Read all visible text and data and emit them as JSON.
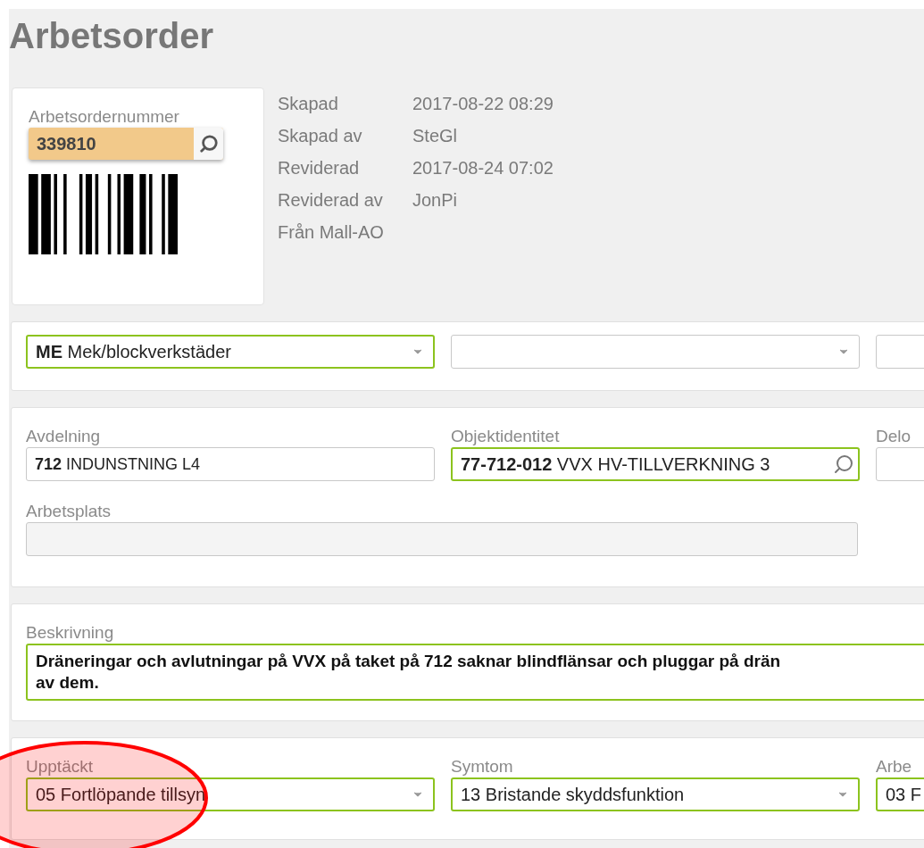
{
  "page_title": "Arbetsorder",
  "order": {
    "label": "Arbetsordernummer",
    "value": "339810"
  },
  "meta": [
    {
      "label": "Skapad",
      "value": "2017-08-22 08:29"
    },
    {
      "label": "Skapad av",
      "value": "SteGl"
    },
    {
      "label": "Reviderad",
      "value": "2017-08-24 07:02"
    },
    {
      "label": "Reviderad av",
      "value": "JonPi"
    },
    {
      "label": "Från Mall-AO"
    }
  ],
  "sections": [
    {
      "fields": [
        {
          "value": "**ME** Mek/blockverkstäder",
          "kind": "select",
          "highlighted": true
        },
        {
          "kind": "select",
          "highlighted": false
        },
        {
          "kind": "input",
          "highlighted": false
        }
      ]
    },
    {
      "fields": [
        {
          "label": "Avdelning",
          "value": "**712** INDUNSTNING L4",
          "kind": "input",
          "highlighted": false
        },
        {
          "label": "Objektidentitet",
          "value": "**77-712-012** VVX HV-TILLVERKNING 3",
          "kind": "search",
          "highlighted": true
        },
        {
          "label": "Delo",
          "kind": "input",
          "highlighted": false
        },
        {
          "label": "Arbetsplats",
          "kind": "wide",
          "highlighted": false
        }
      ]
    },
    {
      "fields": [
        {
          "label": "Beskrivning",
          "lines": [
            "Dräneringar och avlutningar på VVX på taket på 712 saknar blindflänsar och pluggar på drän",
            "av dem."
          ],
          "kind": "textarea",
          "highlighted": true
        }
      ]
    },
    {
      "fields": [
        {
          "label": "Upptäckt",
          "value": "05 Fortlöpande tillsyn",
          "kind": "select",
          "highlighted": true
        },
        {
          "label": "Symtom",
          "value": "13 Bristande skyddsfunktion",
          "kind": "select",
          "highlighted": true
        },
        {
          "label": "Arbe",
          "value": "03 F",
          "kind": "select",
          "highlighted": true
        }
      ]
    }
  ],
  "annotation": {
    "kind": "ellipse",
    "color": "#ff0000"
  }
}
